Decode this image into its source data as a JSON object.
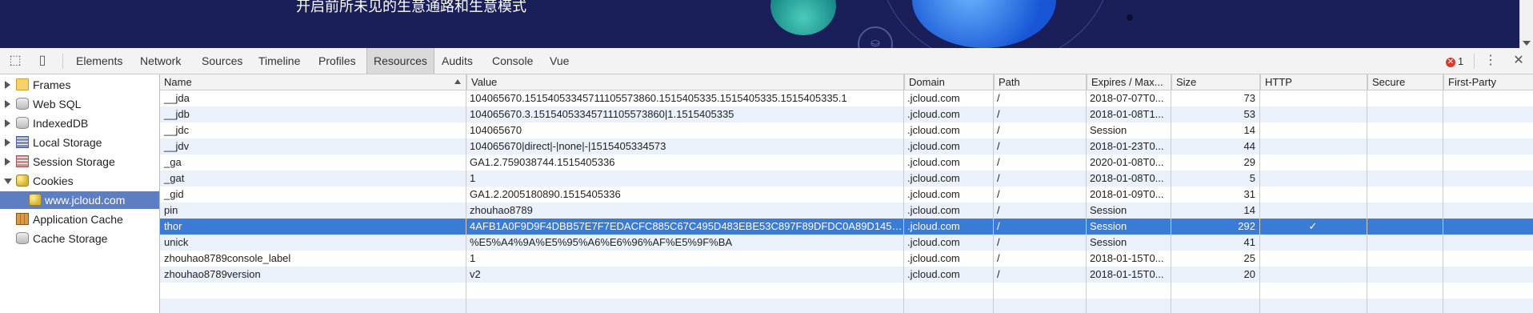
{
  "banner": {
    "text": "开启前所未见的生意通路和生意模式"
  },
  "toolbar": {
    "tabs": [
      "Elements",
      "Network",
      "Sources",
      "Timeline",
      "Profiles",
      "Resources",
      "Audits",
      "Console",
      "Vue"
    ],
    "active_tab": "Resources",
    "error_count": "1"
  },
  "tree": {
    "items": [
      {
        "label": "Frames",
        "icon": "folder-icon"
      },
      {
        "label": "Web SQL",
        "icon": "database-icon"
      },
      {
        "label": "IndexedDB",
        "icon": "database-icon"
      },
      {
        "label": "Local Storage",
        "icon": "local-storage-icon"
      },
      {
        "label": "Session Storage",
        "icon": "session-storage-icon"
      },
      {
        "label": "Cookies",
        "icon": "cookie-icon"
      },
      {
        "label": "www.jcloud.com",
        "icon": "cookie-icon"
      },
      {
        "label": "Application Cache",
        "icon": "app-cache-icon"
      },
      {
        "label": "Cache Storage",
        "icon": "cache-storage-icon"
      }
    ]
  },
  "table": {
    "headers": [
      "Name",
      "Value",
      "Domain",
      "Path",
      "Expires / Max...",
      "Size",
      "HTTP",
      "Secure",
      "First-Party"
    ],
    "rows": [
      [
        "__jda",
        "104065670.1515405334571110557386​0.1515405335.1515405335.1515405335.1",
        ".jcloud.com",
        "/",
        "2018-07-07T0...",
        "73",
        "",
        "",
        ""
      ],
      [
        "__jdb",
        "104065670.3.1515405334571110557386​0|1.1515405335",
        ".jcloud.com",
        "/",
        "2018-01-08T1...",
        "53",
        "",
        "",
        ""
      ],
      [
        "__jdc",
        "104065670",
        ".jcloud.com",
        "/",
        "Session",
        "14",
        "",
        "",
        ""
      ],
      [
        "__jdv",
        "104065670|direct|-|none|-|1515405334573",
        ".jcloud.com",
        "/",
        "2018-01-23T0...",
        "44",
        "",
        "",
        ""
      ],
      [
        "_ga",
        "GA1.2.759038744.1515405336",
        ".jcloud.com",
        "/",
        "2020-01-08T0...",
        "29",
        "",
        "",
        ""
      ],
      [
        "_gat",
        "1",
        ".jcloud.com",
        "/",
        "2018-01-08T0...",
        "5",
        "",
        "",
        ""
      ],
      [
        "_gid",
        "GA1.2.2005180890.1515405336",
        ".jcloud.com",
        "/",
        "2018-01-09T0...",
        "31",
        "",
        "",
        ""
      ],
      [
        "pin",
        "zhouhao8789",
        ".jcloud.com",
        "/",
        "Session",
        "14",
        "",
        "",
        ""
      ],
      [
        "thor",
        "4AFB1A0F9D9F4DBB57E7F7EDACFC885C67C495D483EBE53C897F89DFDC0A89D1458...",
        ".jcloud.com",
        "/",
        "Session",
        "292",
        "✓",
        "",
        ""
      ],
      [
        "unick",
        "%E5%A4%9A%E5%95%A6%E6%96%AF%E5%9F%BA",
        ".jcloud.com",
        "/",
        "Session",
        "41",
        "",
        "",
        ""
      ],
      [
        "zhouhao8789console_label",
        "1",
        ".jcloud.com",
        "/",
        "2018-01-15T0...",
        "25",
        "",
        "",
        ""
      ],
      [
        "zhouhao8789version",
        "v2",
        ".jcloud.com",
        "/",
        "2018-01-15T0...",
        "20",
        "",
        "",
        ""
      ]
    ],
    "selected_row": 8
  },
  "colors": {
    "banner_bg": "#1a1f5a",
    "selected_row": "#3a7bd5",
    "alt_row": "#eaf1fb",
    "tree_selected": "#5d7ec2",
    "error": "#e2362b"
  }
}
